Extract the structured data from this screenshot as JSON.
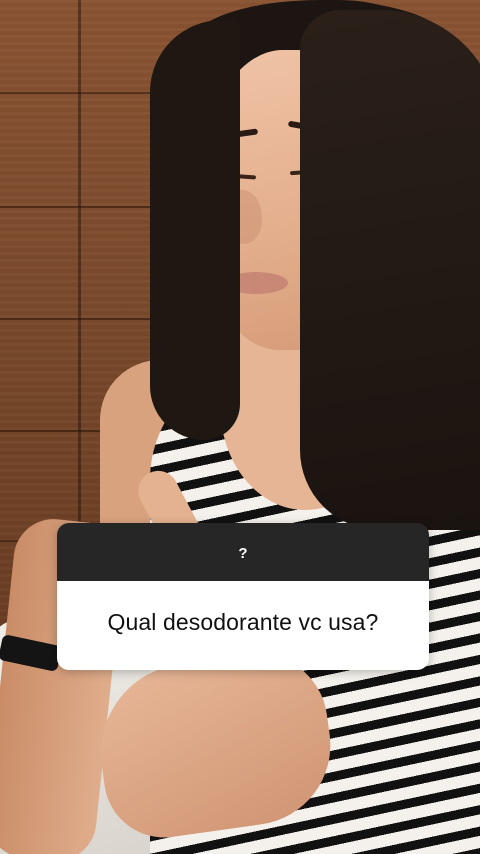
{
  "story": {
    "question_sticker": {
      "header_text": "?",
      "question": "Qual desodorante vc usa?",
      "header_color": "#262626",
      "body_color": "#ffffff"
    }
  }
}
